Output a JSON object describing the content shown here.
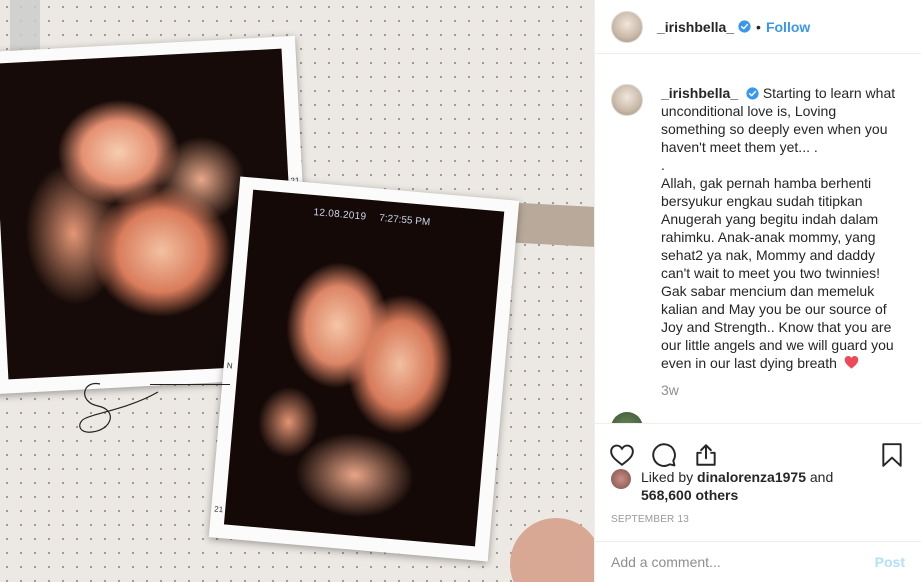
{
  "photo": {
    "scan_date": "12.08.2019",
    "scan_time": "7:27:55 PM",
    "edge_marks": [
      "21",
      "0",
      "21",
      "N"
    ]
  },
  "header": {
    "username": "_irishbella_",
    "separator": "•",
    "follow_label": "Follow"
  },
  "caption": {
    "username": "_irishbella_",
    "lines": [
      "Starting to learn what",
      "unconditional love is, Loving",
      "something so deeply even when you",
      "haven't meet them yet... .",
      ".",
      "Allah, gak pernah hamba berhenti",
      "bersyukur engkau sudah titipkan",
      "Anugerah yang begitu indah dalam",
      "rahimku. Anak-anak mommy, yang",
      "sehat2 ya nak, Mommy and daddy",
      "can't wait to meet you two twinnies!",
      "Gak sabar mencium dan memeluk",
      "kalian and May you be our source of",
      "Joy and Strength.. Know that you are",
      "our little angels and we will guard you",
      "even in our last dying breath"
    ],
    "time_ago": "3w"
  },
  "likes": {
    "prefix": "Liked by",
    "liker": "dinalorenza1975",
    "middle": "and",
    "others": "568,600 others"
  },
  "post_date": "SEPTEMBER 13",
  "comment_box": {
    "placeholder": "Add a comment...",
    "post_label": "Post"
  },
  "colors": {
    "accent": "#3897f0",
    "post_disabled": "#b2dffc",
    "heart": "#ed4956",
    "muted": "#8e8e8e"
  }
}
